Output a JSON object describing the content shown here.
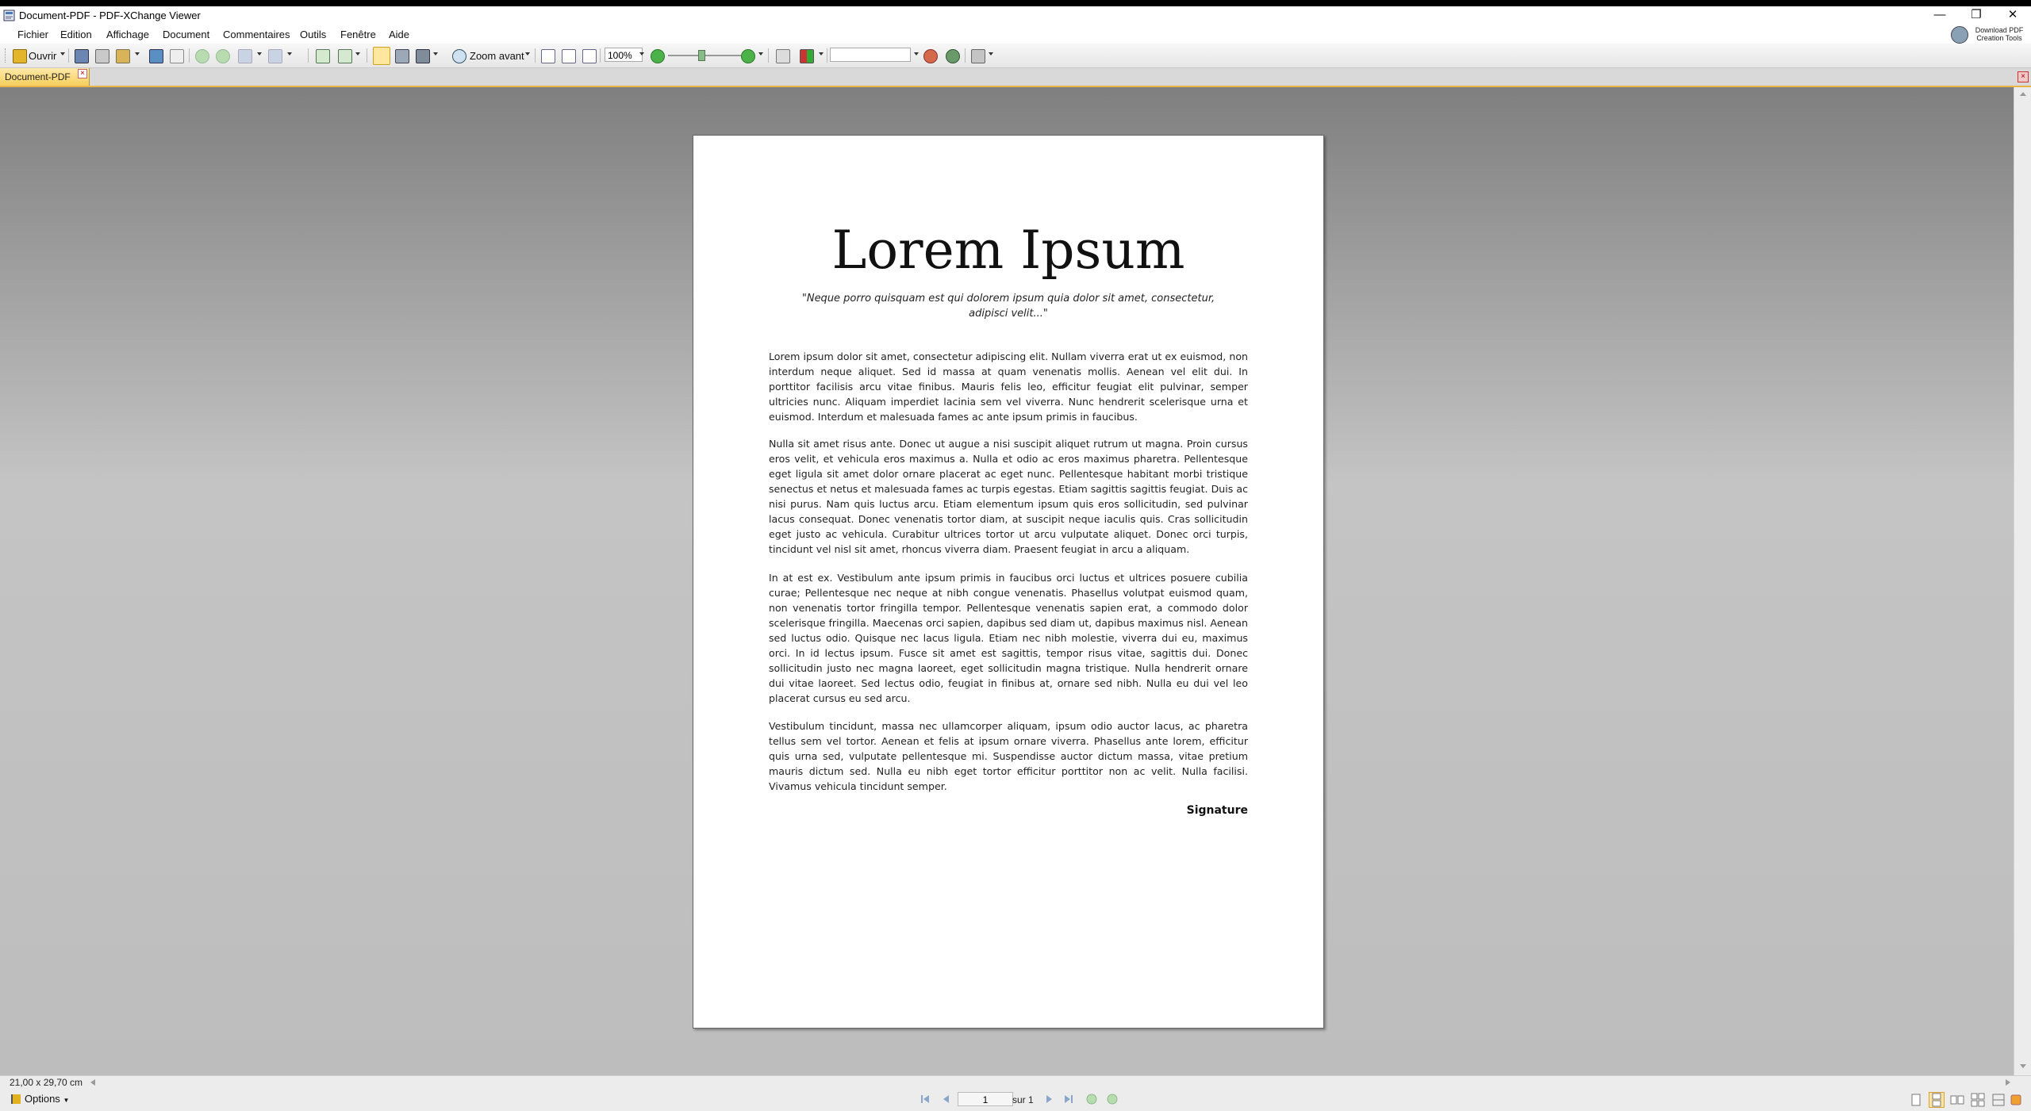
{
  "window": {
    "title": "Document-PDF - PDF-XChange Viewer",
    "minimize_glyph": "—",
    "restore_glyph": "❐",
    "close_glyph": "✕"
  },
  "menu": {
    "items": [
      {
        "label": "Fichier"
      },
      {
        "label": "Edition"
      },
      {
        "label": "Affichage"
      },
      {
        "label": "Document"
      },
      {
        "label": "Commentaires"
      },
      {
        "label": "Outils"
      },
      {
        "label": "Fenêtre"
      },
      {
        "label": "Aide"
      }
    ],
    "download_line1": "Download PDF",
    "download_line2": "Creation Tools"
  },
  "toolbar": {
    "open_label": "Ouvrir",
    "zoom_in_label": "Zoom avant",
    "zoom_value": "100%",
    "search_value": "",
    "icons": [
      "open-icon",
      "save-icon",
      "print-icon",
      "email-icon",
      "scan-icon",
      "ocr-icon",
      "back-icon",
      "forward-icon",
      "undo-icon",
      "redo-icon",
      "rotate-left-icon",
      "rotate-right-icon",
      "hand-tool-icon",
      "select-text-icon",
      "snapshot-icon",
      "zoom-icon",
      "actual-size-icon",
      "fit-page-icon",
      "fit-width-icon",
      "zoom-out-icon",
      "zoom-in-icon",
      "typewriter-icon",
      "highlight-icon",
      "find-icon",
      "search-icon",
      "stamp-icon",
      "tools-icon"
    ]
  },
  "tab": {
    "label": "Document-PDF",
    "close_glyph": "×"
  },
  "document": {
    "title": "Lorem Ipsum",
    "quote": "\"Neque porro quisquam est qui dolorem ipsum quia dolor sit amet, consectetur, adipisci velit...\"",
    "paragraphs": [
      "Lorem ipsum dolor sit amet, consectetur adipiscing elit. Nullam viverra erat ut ex euismod, non interdum neque aliquet. Sed id massa at quam venenatis mollis. Aenean vel elit dui. In porttitor facilisis arcu vitae finibus. Mauris felis leo, efficitur feugiat elit pulvinar, semper ultricies nunc. Aliquam imperdiet lacinia sem vel viverra. Nunc hendrerit scelerisque urna et euismod. Interdum et malesuada fames ac ante ipsum primis in faucibus.",
      "Nulla sit amet risus ante. Donec ut augue a nisi suscipit aliquet rutrum ut magna. Proin cursus eros velit, et vehicula eros maximus a. Nulla et odio ac eros maximus pharetra. Pellentesque eget ligula sit amet dolor ornare placerat ac eget nunc. Pellentesque habitant morbi tristique senectus et netus et malesuada fames ac turpis egestas. Etiam sagittis sagittis feugiat. Duis ac nisi purus. Nam quis luctus arcu. Etiam elementum ipsum quis eros sollicitudin, sed pulvinar lacus consequat. Donec venenatis tortor diam, at suscipit neque iaculis quis. Cras sollicitudin eget justo ac vehicula. Curabitur ultrices tortor ut arcu vulputate aliquet. Donec orci turpis, tincidunt vel nisl sit amet, rhoncus viverra diam. Praesent feugiat in arcu a aliquam.",
      "In at est ex. Vestibulum ante ipsum primis in faucibus orci luctus et ultrices posuere cubilia curae; Pellentesque nec neque at nibh congue venenatis. Phasellus volutpat euismod quam, non venenatis tortor fringilla tempor. Pellentesque venenatis sapien erat, a commodo dolor scelerisque fringilla. Maecenas orci sapien, dapibus sed diam ut, dapibus maximus nisl. Aenean sed luctus odio. Quisque nec lacus ligula. Etiam nec nibh molestie, viverra dui eu, maximus orci. In id lectus ipsum. Fusce sit amet est sagittis, tempor risus vitae, sagittis dui. Donec sollicitudin justo nec magna laoreet, eget sollicitudin magna tristique. Nulla hendrerit ornare dui vitae laoreet. Sed lectus odio, feugiat in finibus at, ornare sed nibh. Nulla eu dui vel leo placerat cursus eu sed arcu.",
      "Vestibulum tincidunt, massa nec ullamcorper aliquam, ipsum odio auctor lacus, ac pharetra tellus sem vel tortor. Aenean et felis at ipsum ornare viverra. Phasellus ante lorem, efficitur quis urna sed, vulputate pellentesque mi. Suspendisse auctor dictum massa, vitae pretium mauris dictum sed. Nulla eu nibh eget tortor efficitur porttitor non ac velit. Nulla facilisi. Vivamus vehicula tincidunt semper."
    ],
    "signature": "Signature"
  },
  "status": {
    "page_size": "21,00 x 29,70 cm",
    "options_label": "Options",
    "current_page": "1",
    "of_label": "sur 1"
  },
  "colors": {
    "tab_active": "#f7cf5c",
    "workspace": "#bdbdbd",
    "accent": "#e8b44a"
  }
}
